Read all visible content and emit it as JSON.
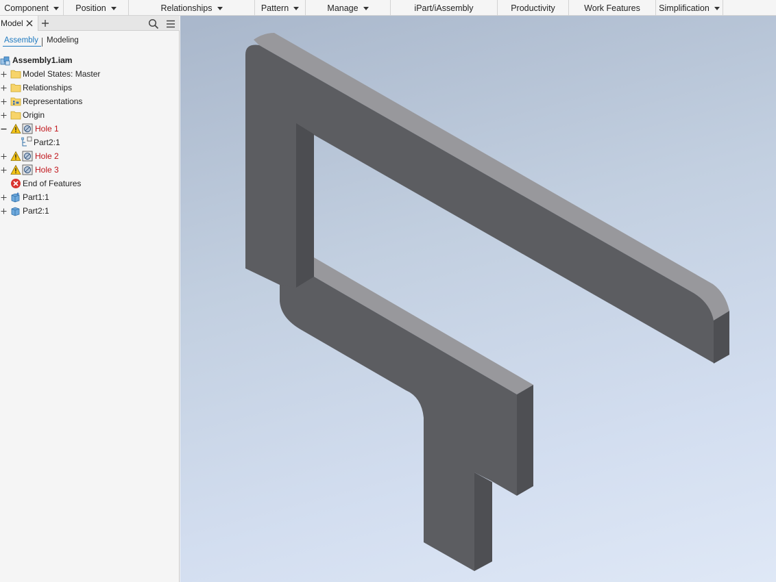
{
  "ribbon": {
    "groups": [
      {
        "label": "Component",
        "dropdown": true
      },
      {
        "label": "Position",
        "dropdown": true
      },
      {
        "label": "Relationships",
        "dropdown": true
      },
      {
        "label": "Pattern",
        "dropdown": true
      },
      {
        "label": "Manage",
        "dropdown": true
      },
      {
        "label": "iPart/iAssembly",
        "dropdown": false
      },
      {
        "label": "Productivity",
        "dropdown": false
      },
      {
        "label": "Work Features",
        "dropdown": false
      },
      {
        "label": "Simplification",
        "dropdown": true
      }
    ]
  },
  "browser": {
    "tab_label": "Model",
    "subtabs": {
      "active": "Assembly",
      "other": "Modeling"
    },
    "tree": [
      {
        "label": "Assembly1.iam",
        "icon": "assembly-icon",
        "style": "bold"
      },
      {
        "label": "Model States: Master",
        "icon": "folder-icon",
        "expander": "plus"
      },
      {
        "label": "Relationships",
        "icon": "folder-icon",
        "expander": "plus"
      },
      {
        "label": "Representations",
        "icon": "representations-folder-icon",
        "expander": "plus"
      },
      {
        "label": "Origin",
        "icon": "folder-icon",
        "expander": "plus"
      },
      {
        "label": "Hole 1",
        "icon": "hole-feature-icon",
        "warning": true,
        "style": "error",
        "expander": "minus"
      },
      {
        "label": "Part2:1",
        "icon": "part-reference-icon",
        "style": "normal"
      },
      {
        "label": "Hole 2",
        "icon": "hole-feature-icon",
        "warning": true,
        "style": "error",
        "expander": "plus"
      },
      {
        "label": "Hole 3",
        "icon": "hole-feature-icon",
        "warning": true,
        "style": "error",
        "expander": "plus"
      },
      {
        "label": "End of Features",
        "icon": "end-of-features-icon"
      },
      {
        "label": "Part1:1",
        "icon": "part-grounded-icon",
        "expander": "plus"
      },
      {
        "label": "Part2:1",
        "icon": "part-icon",
        "expander": "plus"
      }
    ]
  },
  "colors": {
    "error_text": "#c0141a",
    "accent": "#1f7ac0",
    "model_face_front": "#5c5d61",
    "model_face_top": "#98989c",
    "model_face_side": "#4e4f53"
  }
}
